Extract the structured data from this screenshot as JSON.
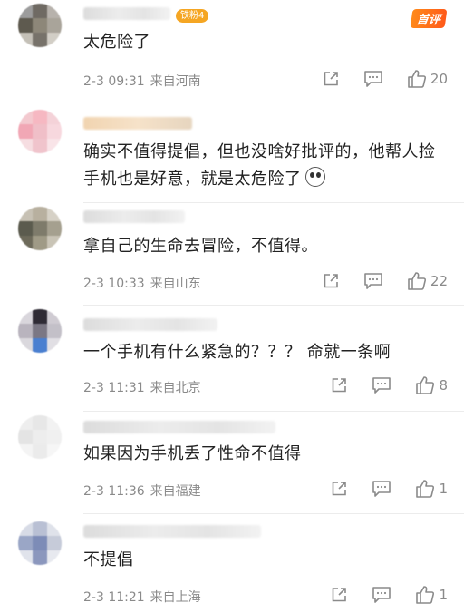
{
  "colors": {
    "hot_badge": "#ff6a1a",
    "fan_badge": "#f5a623",
    "meta_text": "#8a8a8a"
  },
  "comments": [
    {
      "badge": "铁粉4",
      "hot_label": "首评",
      "text": "太危险了",
      "time": "2-3 09:31",
      "location": "来自河南",
      "likes": "20"
    },
    {
      "text": "确实不值得提倡，但也没啥好批评的，他帮人捡手机也是好意，就是太危险了"
    },
    {
      "text": "拿自己的生命去冒险，不值得。",
      "time": "2-3 10:33",
      "location": "来自山东",
      "likes": "22"
    },
    {
      "text": "一个手机有什么紧急的？？？ 命就一条啊",
      "time": "2-3 11:31",
      "location": "来自北京",
      "likes": "8"
    },
    {
      "text": "如果因为手机丢了性命不值得",
      "time": "2-3 11:36",
      "location": "来自福建",
      "likes": "1"
    },
    {
      "text": "不提倡",
      "time": "2-3 11:21",
      "location": "来自上海",
      "likes": "1"
    }
  ]
}
